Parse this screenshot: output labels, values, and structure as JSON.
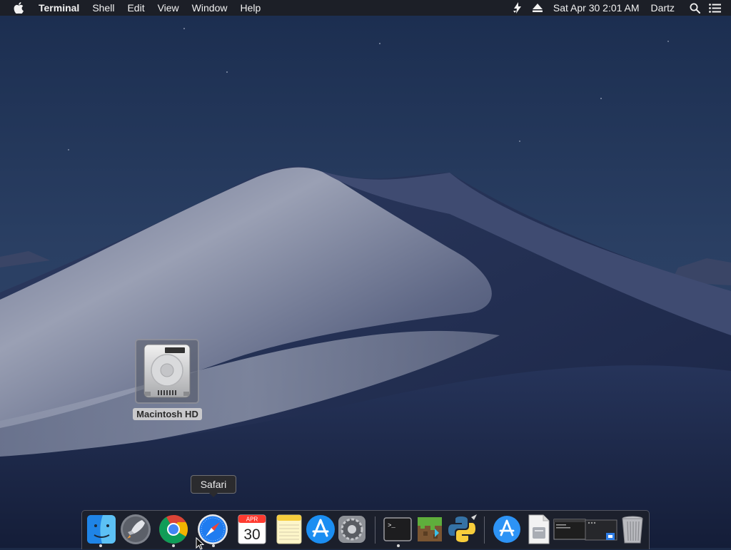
{
  "menubar": {
    "app_name": "Terminal",
    "menus": [
      "Shell",
      "Edit",
      "View",
      "Window",
      "Help"
    ],
    "clock": "Sat Apr 30  2:01 AM",
    "user": "Dartz",
    "status_icons": [
      "apple-logo-icon",
      "drive-sync-icon",
      "eject-icon",
      "spotlight-search-icon",
      "notification-center-icon"
    ]
  },
  "desktop": {
    "items": [
      {
        "label": "Macintosh HD",
        "icon": "hard-drive-icon"
      }
    ]
  },
  "tooltip": {
    "text": "Safari"
  },
  "dock": {
    "apps": [
      {
        "name": "Finder",
        "icon": "finder-icon",
        "running": true
      },
      {
        "name": "Launchpad",
        "icon": "launchpad-icon",
        "running": false
      },
      {
        "name": "Google Chrome",
        "icon": "chrome-icon",
        "running": true
      },
      {
        "name": "Safari",
        "icon": "safari-icon",
        "running": true
      },
      {
        "name": "Calendar",
        "icon": "calendar-icon",
        "running": false,
        "month": "APR",
        "day": "30"
      },
      {
        "name": "Notes",
        "icon": "notes-icon",
        "running": false
      },
      {
        "name": "App Store",
        "icon": "app-store-icon",
        "running": false
      },
      {
        "name": "System Preferences",
        "icon": "system-preferences-icon",
        "running": false
      },
      {
        "name": "Terminal",
        "icon": "terminal-icon",
        "running": true,
        "prompt": ">_"
      },
      {
        "name": "Minecraft",
        "icon": "minecraft-icon",
        "running": false
      },
      {
        "name": "Python Launcher",
        "icon": "python-icon",
        "running": false
      },
      {
        "name": "App Store Downloads",
        "icon": "app-store-folder-icon",
        "running": false
      },
      {
        "name": "Document",
        "icon": "document-icon",
        "running": false
      },
      {
        "name": "Terminal Window",
        "icon": "terminal-window-icon",
        "running": false
      },
      {
        "name": "Screen Recording",
        "icon": "screen-recording-icon",
        "running": false
      },
      {
        "name": "Trash",
        "icon": "trash-icon",
        "running": false
      }
    ]
  },
  "colors": {
    "menubar_bg": "#1c1e24",
    "sky_top": "#1f3356",
    "sky_bottom": "#2a3e62",
    "dune_light": "#8c92a6",
    "dune_dark": "#1b2645",
    "accent_blue": "#1f7cf0"
  }
}
